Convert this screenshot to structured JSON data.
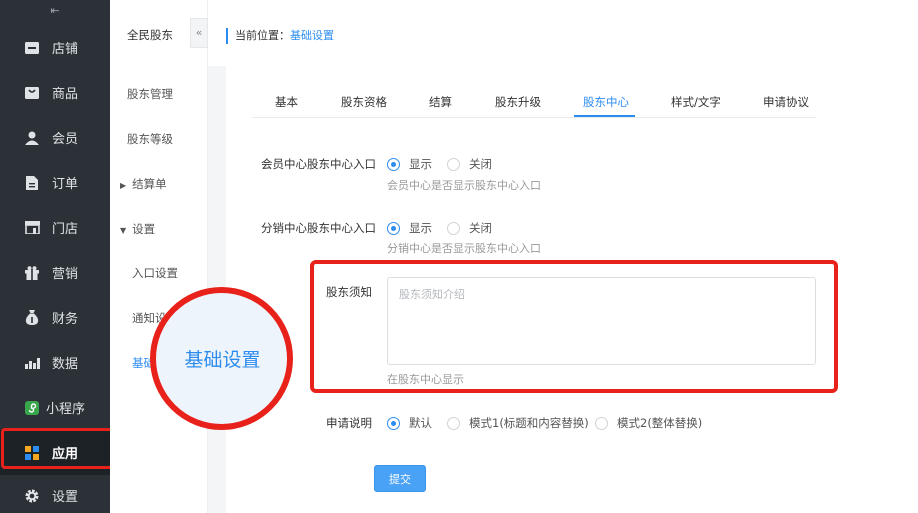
{
  "sidebar": {
    "collapse_glyph": "⇤",
    "items": [
      {
        "label": "店铺",
        "icon": "store-icon"
      },
      {
        "label": "商品",
        "icon": "goods-icon"
      },
      {
        "label": "会员",
        "icon": "member-icon"
      },
      {
        "label": "订单",
        "icon": "order-icon"
      },
      {
        "label": "门店",
        "icon": "shop-icon"
      },
      {
        "label": "营销",
        "icon": "marketing-icon"
      },
      {
        "label": "财务",
        "icon": "finance-icon"
      },
      {
        "label": "数据",
        "icon": "data-icon"
      },
      {
        "label": "小程序",
        "icon": "miniprogram-icon"
      },
      {
        "label": "应用",
        "icon": "apps-icon",
        "active": true
      },
      {
        "label": "设置",
        "icon": "gear-icon"
      }
    ]
  },
  "subnav": {
    "title": "全民股东",
    "toggle": "«",
    "items": {
      "manage": "股东管理",
      "level": "股东等级",
      "settlement": "结算单",
      "settings": "设置",
      "entry": "入口设置",
      "notify": "通知设",
      "basic": "基础"
    }
  },
  "breadcrumb": {
    "prefix": "当前位置：",
    "current": "基础设置"
  },
  "tabs": [
    "基本",
    "股东资格",
    "结算",
    "股东升级",
    "股东中心",
    "样式/文字",
    "申请协议"
  ],
  "active_tab": "股东中心",
  "form": {
    "member_entry": {
      "label": "会员中心股东中心入口",
      "on": "显示",
      "off": "关闭",
      "selected": "显示",
      "hint": "会员中心是否显示股东中心入口"
    },
    "dist_entry": {
      "label": "分销中心股东中心入口",
      "on": "显示",
      "off": "关闭",
      "selected": "显示",
      "hint": "分销中心是否显示股东中心入口"
    },
    "notice": {
      "label": "股东须知",
      "placeholder": "股东须知介绍",
      "value": "",
      "hint": "在股东中心显示"
    },
    "apply_desc": {
      "label": "申请说明",
      "options": [
        "默认",
        "模式1(标题和内容替换)",
        "模式2(整体替换)"
      ],
      "selected": "默认"
    },
    "submit_label": "提交"
  },
  "zoom_callout": "基础设置",
  "colors": {
    "accent": "#2d8cf0",
    "highlight": "#e8221b",
    "sidebar_bg": "#2b3137"
  }
}
